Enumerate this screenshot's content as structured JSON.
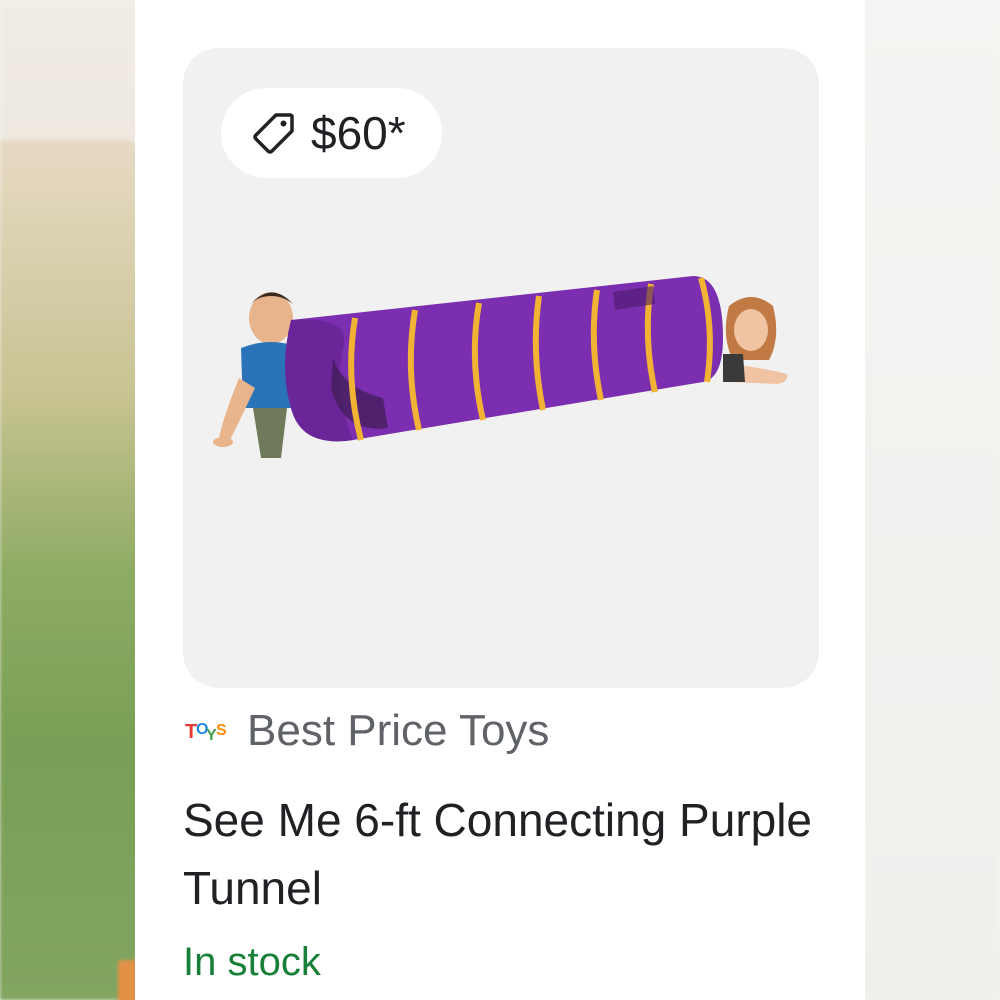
{
  "product": {
    "price": "$60*",
    "store_name": "Best Price Toys",
    "title": "See Me 6-ft Connecting Purple Tunnel",
    "availability": "In stock",
    "store_logo_text": "TOYS"
  },
  "icons": {
    "price_tag": "tag-icon",
    "store_logo": "store-logo-icon"
  },
  "colors": {
    "availability": "#188038",
    "title": "#202124",
    "store_name": "#5f6368",
    "tunnel": "#7b2fb0",
    "tunnel_rings": "#f2b233"
  }
}
